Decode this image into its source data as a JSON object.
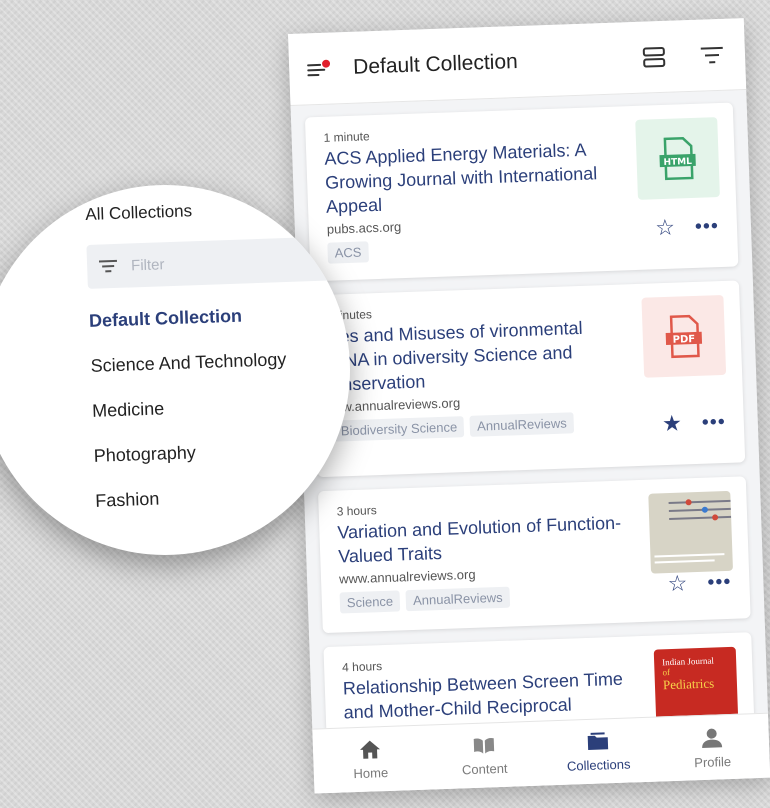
{
  "header": {
    "title": "Default Collection"
  },
  "cards": [
    {
      "ago": "1 minute",
      "title": "ACS Applied Energy Materials: A Growing Journal with International Appeal",
      "source": "pubs.acs.org",
      "tags": [
        "ACS"
      ],
      "thumb": "HTML",
      "starred": false
    },
    {
      "ago": "minutes",
      "title": "ses and Misuses of vironmental DNA in odiversity Science and onservation",
      "source": "ww.annualreviews.org",
      "tags": [
        "Biodiversity Science",
        "AnnualReviews"
      ],
      "thumb": "PDF",
      "starred": true
    },
    {
      "ago": "3 hours",
      "title": "Variation and Evolution of Function-Valued Traits",
      "source": "www.annualreviews.org",
      "tags": [
        "Science",
        "AnnualReviews"
      ],
      "thumb": "image",
      "starred": false
    },
    {
      "ago": "4 hours",
      "title": "Relationship Between Screen Time and Mother-Child Reciprocal Interaction in Typically Developing Children and Children",
      "source": "",
      "tags": [],
      "thumb": "Indian Journal of Pediatrics",
      "starred": false
    }
  ],
  "thumb4": {
    "line1": "Indian Journal",
    "line2": "of",
    "line3": "Pediatrics"
  },
  "nav": [
    {
      "label": "Home",
      "icon": "home-icon"
    },
    {
      "label": "Content",
      "icon": "book-icon"
    },
    {
      "label": "Collections",
      "icon": "folder-icon",
      "active": true
    },
    {
      "label": "Profile",
      "icon": "person-icon"
    }
  ],
  "lens": {
    "all_label": "All Collections",
    "filter_placeholder": "Filter",
    "collections": [
      {
        "label": "Default Collection",
        "active": true
      },
      {
        "label": "Science And Technology"
      },
      {
        "label": "Medicine"
      },
      {
        "label": "Photography"
      },
      {
        "label": "Fashion"
      }
    ]
  },
  "colors": {
    "accent": "#2b3f7a",
    "badge": "#e01e2b",
    "html_green": "#3aa36a",
    "pdf_red": "#e0584a"
  }
}
